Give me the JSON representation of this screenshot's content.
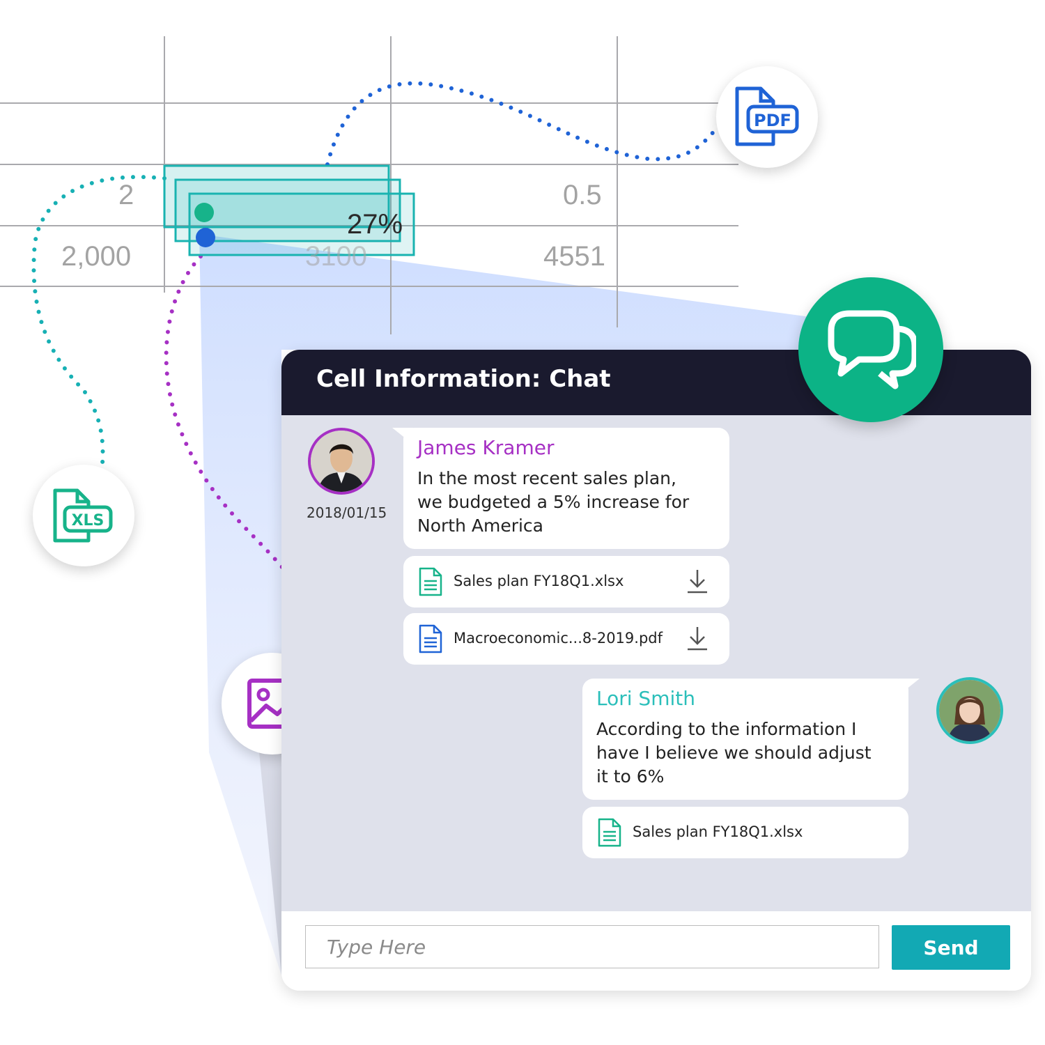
{
  "spreadsheet": {
    "cells": {
      "r1c1": "2",
      "r1c4": "0.5",
      "r2c1": "2,000",
      "r2c3": "3100",
      "r2c4": "4551",
      "selected": "27%"
    }
  },
  "file_type_icons": {
    "pdf_label": "PDF",
    "xls_label": "XLS"
  },
  "chat": {
    "title": "Cell Information: Chat",
    "messages": [
      {
        "sender": "James Kramer",
        "date": "2018/01/15",
        "lines": [
          "In the most recent sales plan,",
          "we budgeted a 5% increase for",
          "North America"
        ],
        "attachments": [
          "Sales plan FY18Q1.xlsx",
          "Macroeconomic...8-2019.pdf"
        ]
      },
      {
        "sender": "Lori Smith",
        "lines": [
          "According to the information I",
          "have I believe we should adjust",
          "it to 6%"
        ],
        "attachments": [
          "Sales plan FY18Q1.xlsx"
        ]
      }
    ],
    "input_placeholder": "Type Here",
    "send_label": "Send"
  },
  "colors": {
    "header_bg": "#1a1a2e",
    "chat_bg": "#dfe1eb",
    "send": "#12a9b4",
    "chat_icon_bg": "#0cb386",
    "james": "#a630c4",
    "lori": "#2bbfba",
    "pdf_blue": "#1f63d6",
    "xls_green": "#17b38a",
    "image_purple": "#a630c4"
  },
  "icons": [
    "pdf-file-icon",
    "xls-file-icon",
    "image-icon",
    "chat-bubbles-icon",
    "spreadsheet-file-icon",
    "document-file-icon",
    "download-icon"
  ]
}
